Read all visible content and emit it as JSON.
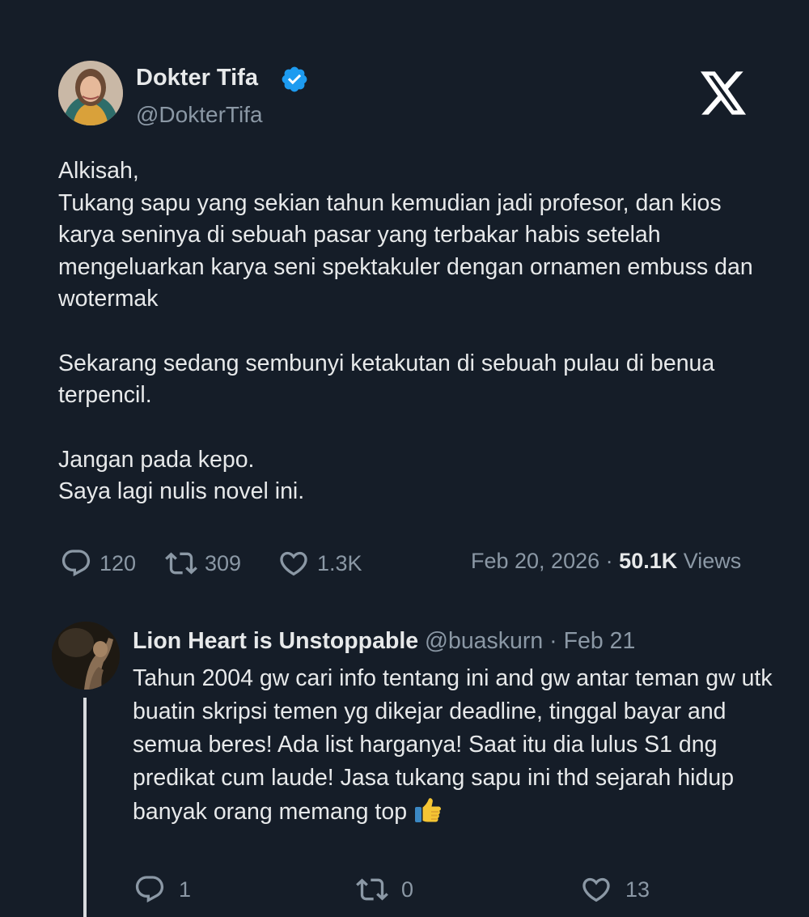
{
  "tweet": {
    "author": {
      "name": "Dokter Tifa",
      "handle": "@DokterTifa",
      "verified": true
    },
    "paragraphs": [
      "Alkisah,\nTukang sapu yang sekian tahun kemudian jadi profesor, dan kios karya seninya di sebuah pasar yang terbakar habis setelah mengeluarkan karya seni spektakuler dengan ornamen embuss dan wotermak",
      "Sekarang sedang sembunyi ketakutan di sebuah pulau di benua terpencil.",
      "Jangan pada kepo.\nSaya lagi nulis novel ini."
    ],
    "stats": {
      "replies": "120",
      "retweets": "309",
      "likes": "1.3K",
      "date": "Feb 20, 2026",
      "separator": "·",
      "views_count": "50.1K",
      "views_label": "Views"
    }
  },
  "reply": {
    "author": {
      "name": "Lion Heart is Unstoppable",
      "handle": "@buaskurn",
      "separator": "·",
      "date": "Feb 21"
    },
    "text": "Tahun 2004 gw cari info tentang ini and gw antar teman gw utk buatin skripsi temen yg dikejar deadline, tinggal bayar and semua beres! Ada list harganya! Saat itu dia lulus S1 dng predikat cum laude! Jasa tukang sapu ini thd sejarah hidup banyak orang memang top",
    "emoji": "thumbs-up-icon",
    "stats": {
      "replies": "1",
      "retweets": "0",
      "likes": "13"
    }
  },
  "colors": {
    "background": "#151d28",
    "text": "#e7e9ea",
    "muted": "#8b98a5",
    "verified": "#1d9bf0"
  }
}
